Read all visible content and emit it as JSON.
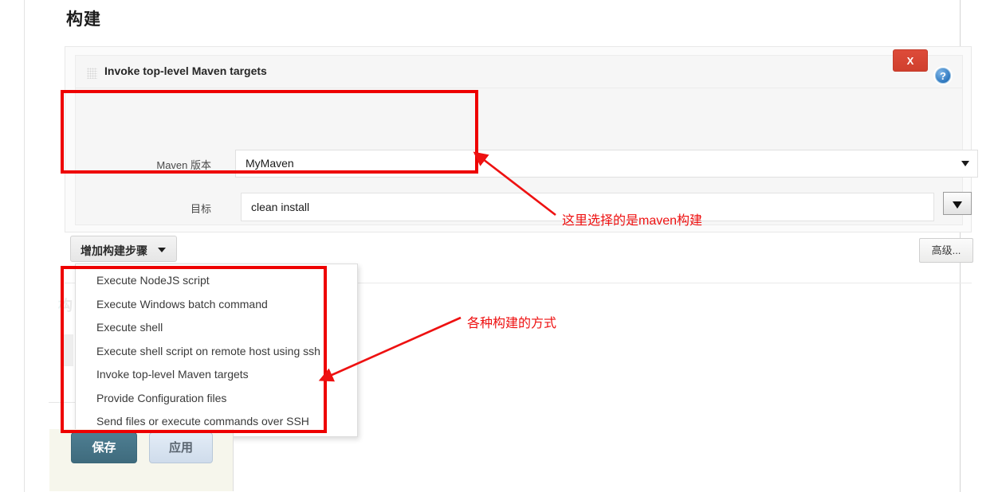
{
  "page": {
    "section_title": "构建",
    "obscured_heading": "构"
  },
  "build_step": {
    "panel_title": "Invoke top-level Maven targets",
    "grip_icon": "drag-handle-icon",
    "delete_label": "X",
    "help_icon": "?",
    "fields": {
      "maven_version_label": "Maven 版本",
      "maven_version_value": "MyMaven",
      "goals_label": "目标",
      "goals_value": "clean install",
      "goals_placeholder": ""
    },
    "advanced_label": "高级..."
  },
  "add_build_step": {
    "label": "增加构建步骤",
    "caret_icon": "chevron-down-icon",
    "menu_items": [
      "Execute NodeJS script",
      "Execute Windows batch command",
      "Execute shell",
      "Execute shell script on remote host using ssh",
      "Invoke top-level Maven targets",
      "Provide Configuration files",
      "Send files or execute commands over SSH"
    ]
  },
  "footer": {
    "save_label": "保存",
    "apply_label": "应用"
  },
  "annotations": {
    "maven_note": "这里选择的是maven构建",
    "menu_note": "各种构建的方式",
    "color": "#ee1111"
  }
}
